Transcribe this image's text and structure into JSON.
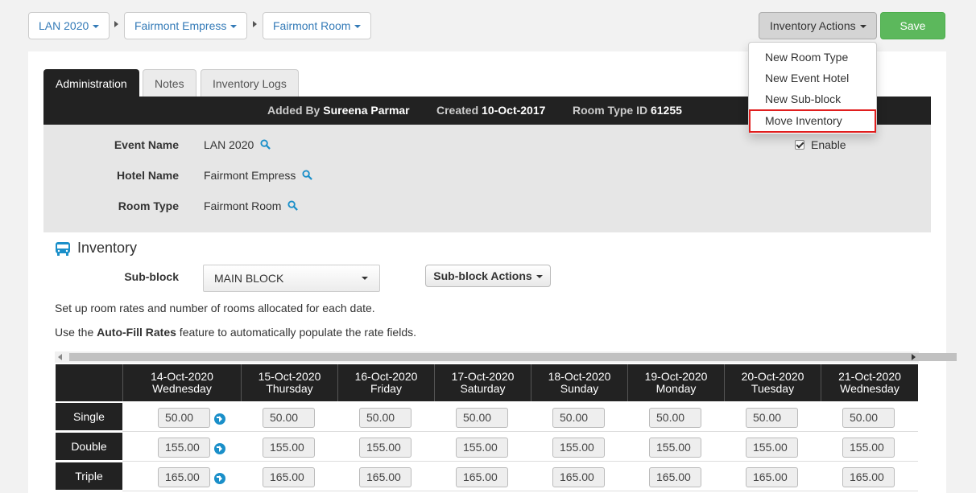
{
  "breadcrumb": {
    "event": "LAN 2020",
    "hotel": "Fairmont Empress",
    "room": "Fairmont Room"
  },
  "toolbar": {
    "actions_label": "Inventory Actions",
    "save_label": "Save"
  },
  "actions_menu": {
    "items": [
      "New Room Type",
      "New Event Hotel",
      "New Sub-block",
      "Move Inventory"
    ],
    "highlighted": "Move Inventory"
  },
  "tabs": [
    "Administration",
    "Notes",
    "Inventory Logs"
  ],
  "active_tab": "Administration",
  "info": {
    "added_by_label": "Added By",
    "added_by": "Sureena Parmar",
    "created_label": "Created",
    "created": "10-Oct-2017",
    "room_type_id_label": "Room Type ID",
    "room_type_id": "61255"
  },
  "details": {
    "event_name_label": "Event Name",
    "event_name": "LAN 2020",
    "hotel_name_label": "Hotel Name",
    "hotel_name": "Fairmont Empress",
    "room_type_label": "Room Type",
    "room_type": "Fairmont Room",
    "enable_label": "Enable",
    "enable_checked": true
  },
  "inventory": {
    "title": "Inventory",
    "subblock_label": "Sub-block",
    "subblock_value": "MAIN BLOCK",
    "subblock_actions_label": "Sub-block Actions",
    "help_line1": "Set up room rates and number of rooms allocated for each date.",
    "help_line2_prefix": "Use the ",
    "help_line2_bold": "Auto-Fill Rates",
    "help_line2_suffix": " feature to automatically populate the rate fields."
  },
  "rates_table": {
    "dates": [
      {
        "date": "14-Oct-2020",
        "day": "Wednesday"
      },
      {
        "date": "15-Oct-2020",
        "day": "Thursday"
      },
      {
        "date": "16-Oct-2020",
        "day": "Friday"
      },
      {
        "date": "17-Oct-2020",
        "day": "Saturday"
      },
      {
        "date": "18-Oct-2020",
        "day": "Sunday"
      },
      {
        "date": "19-Oct-2020",
        "day": "Monday"
      },
      {
        "date": "20-Oct-2020",
        "day": "Tuesday"
      },
      {
        "date": "21-Oct-2020",
        "day": "Wednesday"
      }
    ],
    "rows": [
      {
        "label": "Single",
        "rates": [
          "50.00",
          "50.00",
          "50.00",
          "50.00",
          "50.00",
          "50.00",
          "50.00",
          "50.00"
        ]
      },
      {
        "label": "Double",
        "rates": [
          "155.00",
          "155.00",
          "155.00",
          "155.00",
          "155.00",
          "155.00",
          "155.00",
          "155.00"
        ]
      },
      {
        "label": "Triple",
        "rates": [
          "165.00",
          "165.00",
          "165.00",
          "165.00",
          "165.00",
          "165.00",
          "165.00",
          "165.00"
        ]
      }
    ]
  }
}
